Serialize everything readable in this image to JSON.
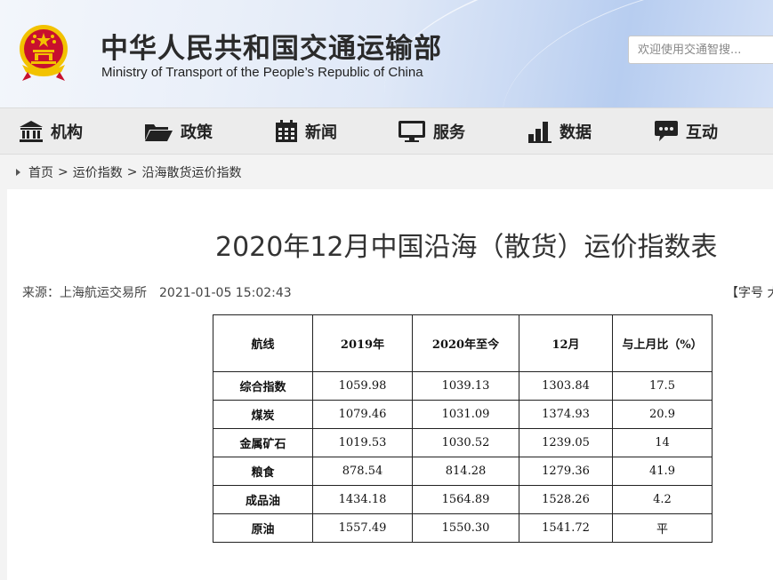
{
  "header": {
    "title": "中华人民共和国交通运输部",
    "subtitle": "Ministry of Transport of the People’s Republic of China",
    "search_placeholder": "欢迎使用交通智搜..."
  },
  "nav": {
    "items": [
      {
        "label": "机构",
        "icon": "building-icon"
      },
      {
        "label": "政策",
        "icon": "folder-icon"
      },
      {
        "label": "新闻",
        "icon": "calendar-icon"
      },
      {
        "label": "服务",
        "icon": "monitor-icon"
      },
      {
        "label": "数据",
        "icon": "bar-chart-icon"
      },
      {
        "label": "互动",
        "icon": "chat-bubble-icon"
      }
    ]
  },
  "breadcrumb": {
    "items": [
      "首页",
      "运价指数",
      "沿海散货运价指数"
    ],
    "separator": ">"
  },
  "article": {
    "title": "2020年12月中国沿海（散货）运价指数表",
    "source": "来源：上海航运交易所",
    "time": "2021-01-05 15:02:43",
    "font_size_label": "【字号 大"
  },
  "table": {
    "headers": [
      "航线",
      "2019年",
      "2020年至今",
      "12月",
      "与上月比（%）"
    ],
    "rows": [
      [
        "综合指数",
        "1059.98",
        "1039.13",
        "1303.84",
        "17.5"
      ],
      [
        "煤炭",
        "1079.46",
        "1031.09",
        "1374.93",
        "20.9"
      ],
      [
        "金属矿石",
        "1019.53",
        "1030.52",
        "1239.05",
        "14"
      ],
      [
        "粮食",
        "878.54",
        "814.28",
        "1279.36",
        "41.9"
      ],
      [
        "成品油",
        "1434.18",
        "1564.89",
        "1528.26",
        "4.2"
      ],
      [
        "原油",
        "1557.49",
        "1550.30",
        "1541.72",
        "平"
      ]
    ]
  },
  "colors": {
    "emblem_red": "#c8102e",
    "emblem_gold": "#f2c200",
    "nav_bg": "#ececec"
  }
}
